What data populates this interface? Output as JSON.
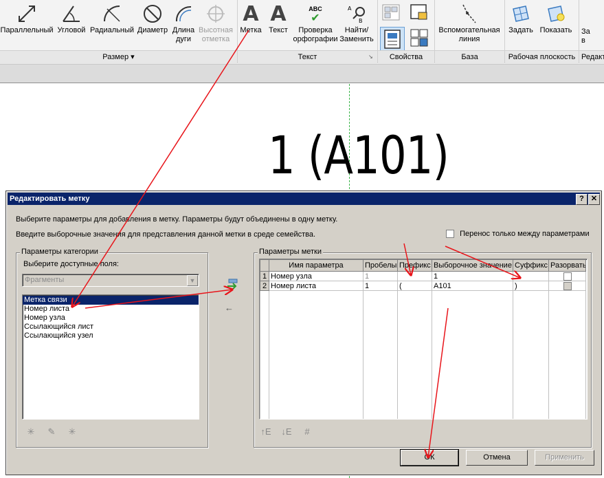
{
  "ribbon": {
    "dimension_tools": [
      {
        "label": "Параллельный",
        "icon": "aligned-dimension-icon",
        "disabled": false
      },
      {
        "label": "Угловой",
        "icon": "angular-dimension-icon",
        "disabled": false
      },
      {
        "label": "Радиальный",
        "icon": "radial-dimension-icon",
        "disabled": false
      },
      {
        "label": "Диаметр",
        "icon": "diameter-dimension-icon",
        "disabled": false
      },
      {
        "label": "Длина\nдуги",
        "icon": "arc-length-icon",
        "disabled": false
      },
      {
        "label": "Высотная\nотметка",
        "icon": "spot-elevation-icon",
        "disabled": true
      }
    ],
    "text_tools": [
      {
        "label": "Метка",
        "icon": "label-icon"
      },
      {
        "label": "Текст",
        "icon": "text-icon"
      },
      {
        "label": "Проверка\nорфографии",
        "icon": "spellcheck-icon",
        "glyph": "ABC"
      },
      {
        "label": "Найти/\nЗаменить",
        "icon": "find-replace-icon"
      }
    ],
    "base_tools": [
      {
        "label": "Вспомогательная\nлиния",
        "icon": "reference-line-icon"
      }
    ],
    "workplane_tools": [
      {
        "label": "Задать",
        "icon": "set-workplane-icon"
      },
      {
        "label": "Показать",
        "icon": "show-workplane-icon"
      }
    ],
    "overflow_label": "За\nв",
    "groups": {
      "dimension": "Размер ▾",
      "text": "Текст",
      "properties": "Свойства",
      "base": "База",
      "workplane": "Рабочая плоскость",
      "edit": "Редакт"
    }
  },
  "canvas": {
    "tag_text": "1 (A101)"
  },
  "dialog": {
    "title": "Редактировать метку",
    "help_btn": "?",
    "close_btn": "✕",
    "intro1": "Выберите параметры для добавления в метку.  Параметры будут объединены в одну метку.",
    "intro2": "Введите выборочные значения для представления данной метки в среде семейства.",
    "wrap_checkbox": "Перенос только между параметрами",
    "category": {
      "legend": "Параметры категории",
      "fields_label": "Выберите доступные поля:",
      "dropdown": "Фрагменты",
      "fields": [
        "Метка связи",
        "Номер листа",
        "Номер узла",
        "Ссылающийся лист",
        "Ссылающийся узел"
      ],
      "selected_index": 0
    },
    "label_params": {
      "legend": "Параметры метки",
      "columns": [
        "Имя параметра",
        "Пробелы",
        "Префикс",
        "Выборочное значение",
        "Суффикс",
        "Разорвать"
      ],
      "rows": [
        {
          "n": "1",
          "name": "Номер узла",
          "spaces": "1",
          "prefix": "",
          "sample": "1",
          "suffix": ""
        },
        {
          "n": "2",
          "name": "Номер листа",
          "spaces": "1",
          "prefix": "(",
          "sample": "A101",
          "suffix": ")"
        }
      ]
    },
    "buttons": {
      "ok": "ОК",
      "cancel": "Отмена",
      "apply": "Применить"
    }
  },
  "colors": {
    "title_bar": "#0a246a",
    "dialog_bg": "#d4d0c8",
    "annotation_arrow": "#e8141a",
    "guide_line": "#3bb54a"
  }
}
